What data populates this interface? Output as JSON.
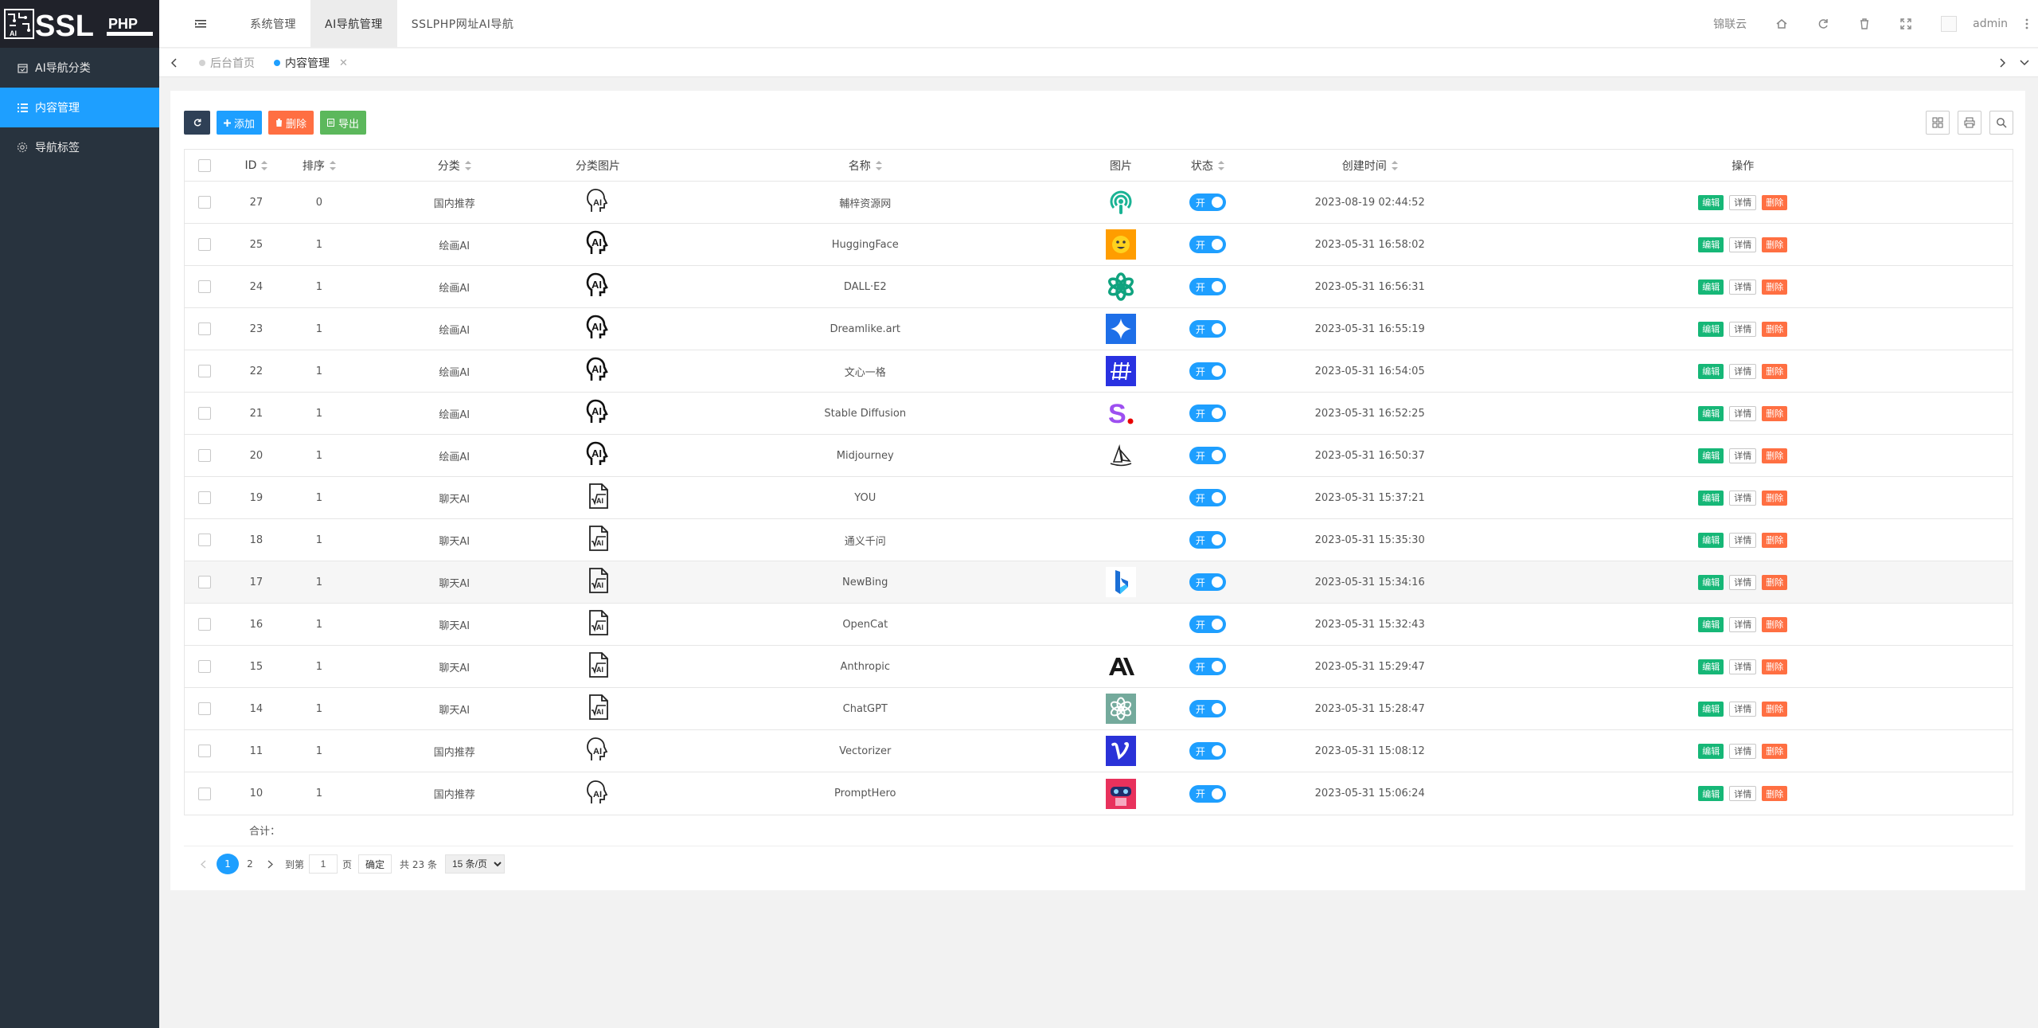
{
  "logo": {
    "text": "SSL",
    "sub": "PHP"
  },
  "sidebar": {
    "items": [
      {
        "label": "AI导航分类",
        "icon": "calendar-check-icon"
      },
      {
        "label": "内容管理",
        "icon": "list-icon"
      },
      {
        "label": "导航标签",
        "icon": "gear-icon"
      }
    ]
  },
  "header": {
    "menu": [
      "系统管理",
      "AI导航管理",
      "SSLPHP网址AI导航"
    ],
    "right_link": "锦联云",
    "user": "admin"
  },
  "tabs": [
    {
      "label": "后台首页"
    },
    {
      "label": "内容管理"
    }
  ],
  "toolbar": {
    "add": "添加",
    "delete": "删除",
    "export": "导出"
  },
  "table": {
    "headers": {
      "id": "ID",
      "sort": "排序",
      "category": "分类",
      "category_image": "分类图片",
      "name": "名称",
      "image": "图片",
      "status": "状态",
      "created": "创建时间",
      "actions": "操作"
    },
    "toggle_label": "开",
    "edit": "编辑",
    "detail": "详情",
    "delete": "删除",
    "rows": [
      {
        "id": "27",
        "sort": "0",
        "category": "国内推荐",
        "cimg": "head-ai-icon",
        "name": "輔梓资源网",
        "logo": "podcast-logo",
        "time": "2023-08-19 02:44:52"
      },
      {
        "id": "25",
        "sort": "1",
        "category": "绘画AI",
        "cimg": "head-ai-bold-icon",
        "name": "HuggingFace",
        "logo": "huggingface-logo",
        "time": "2023-05-31 16:58:02"
      },
      {
        "id": "24",
        "sort": "1",
        "category": "绘画AI",
        "cimg": "head-ai-bold-icon",
        "name": "DALL·E2",
        "logo": "openai-green-logo",
        "time": "2023-05-31 16:56:31"
      },
      {
        "id": "23",
        "sort": "1",
        "category": "绘画AI",
        "cimg": "head-ai-bold-icon",
        "name": "Dreamlike.art",
        "logo": "dreamlike-logo",
        "time": "2023-05-31 16:55:19"
      },
      {
        "id": "22",
        "sort": "1",
        "category": "绘画AI",
        "cimg": "head-ai-bold-icon",
        "name": "文心一格",
        "logo": "wenxin-logo",
        "time": "2023-05-31 16:54:05"
      },
      {
        "id": "21",
        "sort": "1",
        "category": "绘画AI",
        "cimg": "head-ai-bold-icon",
        "name": "Stable Diffusion",
        "logo": "stability-logo",
        "time": "2023-05-31 16:52:25"
      },
      {
        "id": "20",
        "sort": "1",
        "category": "绘画AI",
        "cimg": "head-ai-bold-icon",
        "name": "Midjourney",
        "logo": "midjourney-logo",
        "time": "2023-05-31 16:50:37"
      },
      {
        "id": "19",
        "sort": "1",
        "category": "聊天AI",
        "cimg": "doc-ai-icon",
        "name": "YOU",
        "logo": "",
        "time": "2023-05-31 15:37:21"
      },
      {
        "id": "18",
        "sort": "1",
        "category": "聊天AI",
        "cimg": "doc-ai-icon",
        "name": "通义千问",
        "logo": "",
        "time": "2023-05-31 15:35:30"
      },
      {
        "id": "17",
        "sort": "1",
        "category": "聊天AI",
        "cimg": "doc-ai-icon",
        "name": "NewBing",
        "logo": "bing-logo",
        "time": "2023-05-31 15:34:16"
      },
      {
        "id": "16",
        "sort": "1",
        "category": "聊天AI",
        "cimg": "doc-ai-icon",
        "name": "OpenCat",
        "logo": "",
        "time": "2023-05-31 15:32:43"
      },
      {
        "id": "15",
        "sort": "1",
        "category": "聊天AI",
        "cimg": "doc-ai-icon",
        "name": "Anthropic",
        "logo": "anthropic-logo",
        "time": "2023-05-31 15:29:47"
      },
      {
        "id": "14",
        "sort": "1",
        "category": "聊天AI",
        "cimg": "doc-ai-icon",
        "name": "ChatGPT",
        "logo": "chatgpt-logo",
        "time": "2023-05-31 15:28:47"
      },
      {
        "id": "11",
        "sort": "1",
        "category": "国内推荐",
        "cimg": "head-ai-icon",
        "name": "Vectorizer",
        "logo": "vectorizer-logo",
        "time": "2023-05-31 15:08:12"
      },
      {
        "id": "10",
        "sort": "1",
        "category": "国内推荐",
        "cimg": "head-ai-icon",
        "name": "PromptHero",
        "logo": "prompthero-logo",
        "time": "2023-05-31 15:06:24"
      }
    ],
    "total_label": "合计："
  },
  "pager": {
    "pages": [
      "1",
      "2"
    ],
    "goto_prefix": "到第",
    "goto_value": "1",
    "goto_suffix": "页",
    "confirm": "确定",
    "count": "共 23 条",
    "per_page": "15 条/页"
  }
}
